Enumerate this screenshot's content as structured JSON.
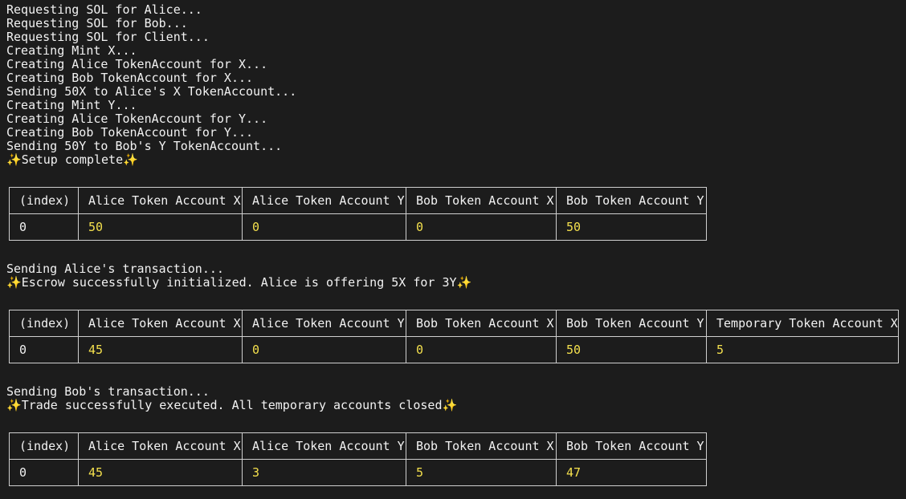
{
  "log_setup": [
    "Requesting SOL for Alice...",
    "Requesting SOL for Bob...",
    "Requesting SOL for Client...",
    "Creating Mint X...",
    "Creating Alice TokenAccount for X...",
    "Creating Bob TokenAccount for X...",
    "Sending 50X to Alice's X TokenAccount...",
    "Creating Mint Y...",
    "Creating Alice TokenAccount for Y...",
    "Creating Bob TokenAccount for Y...",
    "Sending 50Y to Bob's Y TokenAccount..."
  ],
  "sparkle": "✨",
  "setup_complete": "Setup complete",
  "table_setup": {
    "headers": [
      "(index)",
      "Alice Token Account X",
      "Alice Token Account Y",
      "Bob Token Account X",
      "Bob Token Account Y"
    ],
    "row": [
      "0",
      "50",
      "0",
      "0",
      "50"
    ]
  },
  "log_init": {
    "sending": "Sending Alice's transaction...",
    "message": "Escrow successfully initialized. Alice is offering 5X for 3Y"
  },
  "table_init": {
    "headers": [
      "(index)",
      "Alice Token Account X",
      "Alice Token Account Y",
      "Bob Token Account X",
      "Bob Token Account Y",
      "Temporary Token Account X"
    ],
    "row": [
      "0",
      "45",
      "0",
      "0",
      "50",
      "5"
    ]
  },
  "log_trade": {
    "sending": "Sending Bob's transaction...",
    "message": "Trade successfully executed. All temporary accounts closed"
  },
  "table_trade": {
    "headers": [
      "(index)",
      "Alice Token Account X",
      "Alice Token Account Y",
      "Bob Token Account X",
      "Bob Token Account Y"
    ],
    "row": [
      "0",
      "45",
      "3",
      "5",
      "47"
    ]
  }
}
